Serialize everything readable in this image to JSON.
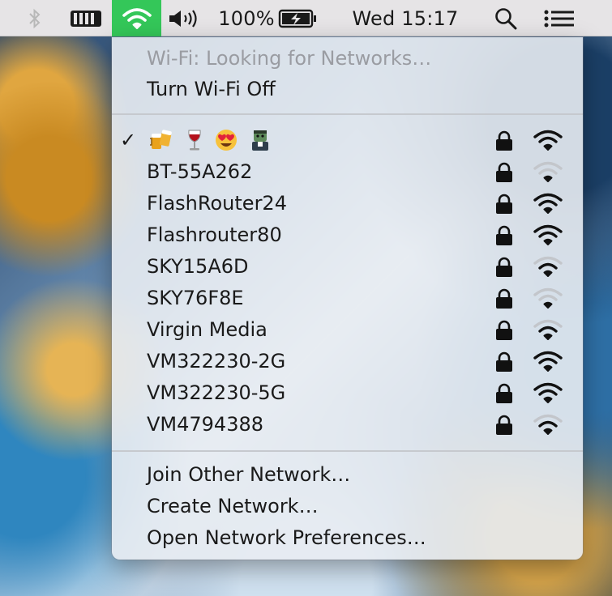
{
  "menubar": {
    "battery_percent": "100%",
    "clock": "Wed 15:17",
    "icons": [
      "bluetooth-icon",
      "battery-menu-icon",
      "wifi-icon",
      "volume-icon",
      "battery-charging-icon",
      "spotlight-icon",
      "notification-center-icon"
    ]
  },
  "wifi_menu": {
    "status": "Wi-Fi: Looking for Networks…",
    "toggle": "Turn Wi-Fi Off",
    "connected_mark": "✓",
    "connected_network_icons": [
      "beer-mugs-emoji",
      "wine-glass-emoji",
      "heart-eyes-emoji",
      "zombie-emoji"
    ],
    "networks": [
      {
        "name": "BT-55A262",
        "locked": true,
        "signal": 1
      },
      {
        "name": "FlashRouter24",
        "locked": true,
        "signal": 3
      },
      {
        "name": "Flashrouter80",
        "locked": true,
        "signal": 3
      },
      {
        "name": "SKY15A6D",
        "locked": true,
        "signal": 2
      },
      {
        "name": "SKY76F8E",
        "locked": true,
        "signal": 1
      },
      {
        "name": "Virgin Media",
        "locked": true,
        "signal": 2
      },
      {
        "name": "VM322230-2G",
        "locked": true,
        "signal": 3
      },
      {
        "name": "VM322230-5G",
        "locked": true,
        "signal": 3
      },
      {
        "name": "VM4794388",
        "locked": true,
        "signal": 2
      }
    ],
    "connected_signal": 3,
    "join_other": "Join Other Network…",
    "create": "Create Network…",
    "preferences": "Open Network Preferences…"
  },
  "colors": {
    "wifi_highlight": "#34c759"
  }
}
